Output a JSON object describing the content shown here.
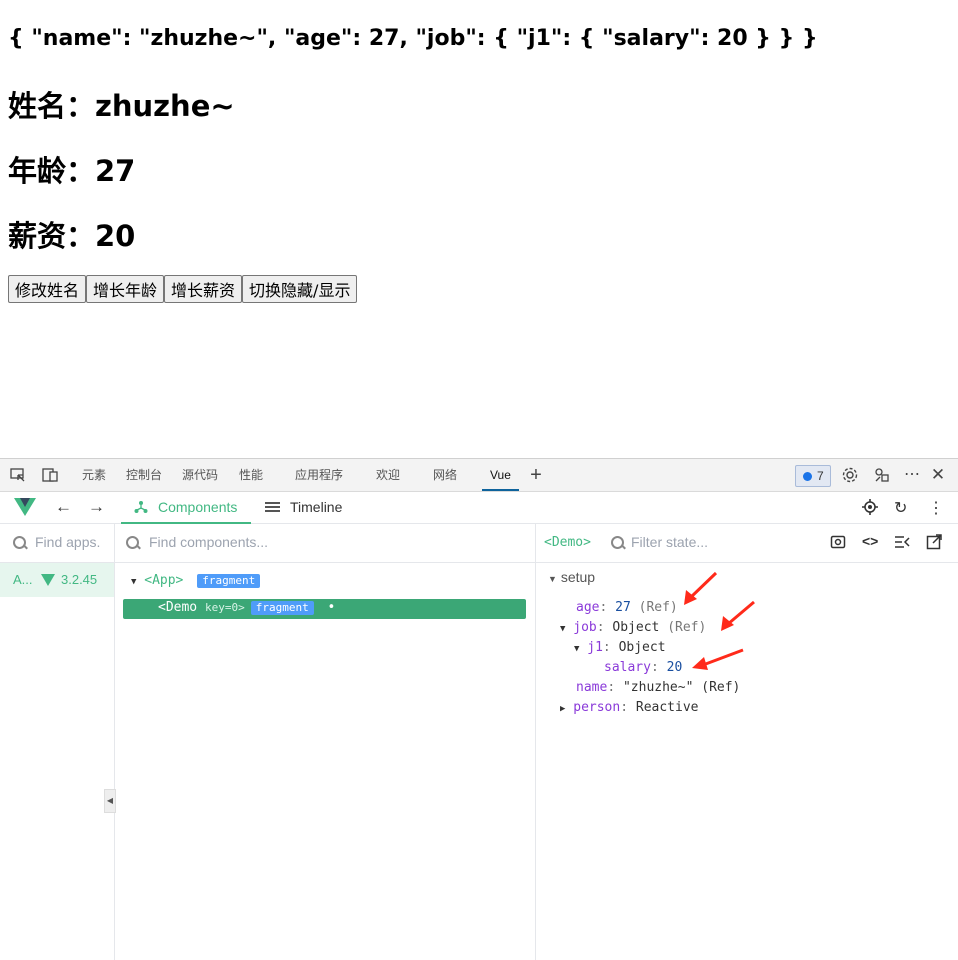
{
  "page": {
    "json_text": "{ \"name\": \"zhuzhe~\", \"age\": 27, \"job\": { \"j1\": { \"salary\": 20 } } }",
    "name_line": "姓名：zhuzhe~",
    "age_line": "年龄：27",
    "salary_line": "薪资：20",
    "buttons": [
      "修改姓名",
      "增长年龄",
      "增长薪资",
      "切换隐藏/显示"
    ]
  },
  "devtools": {
    "tabs": [
      "元素",
      "控制台",
      "源代码",
      "性能",
      "应用程序",
      "欢迎",
      "网络",
      "Vue"
    ],
    "issues_count": "7",
    "vue_tabs": {
      "components": "Components",
      "timeline": "Timeline"
    },
    "apps_search_placeholder": "Find apps.",
    "components_search_placeholder": "Find components...",
    "app_item": {
      "label": "A...",
      "version": "3.2.45"
    },
    "tree": {
      "root": "<App>",
      "root_badge": "fragment",
      "selected_name": "<Demo",
      "selected_key_label": "key",
      "selected_key_value": "=0>",
      "selected_badge": "fragment",
      "selected_dot": "•"
    },
    "state": {
      "crumb": "<Demo>",
      "filter_placeholder": "Filter state...",
      "section": "setup",
      "rows": {
        "age_key": "age",
        "age_val": "27",
        "age_meta": "(Ref)",
        "job_key": "job",
        "job_val": "Object",
        "job_meta": "(Ref)",
        "j1_key": "j1",
        "j1_val": "Object",
        "salary_key": "salary",
        "salary_val": "20",
        "name_key": "name",
        "name_val": "\"zhuzhe~\"",
        "name_meta": "(Ref)",
        "person_key": "person",
        "person_val": "Reactive"
      }
    }
  },
  "colors": {
    "vue_green": "#42b883",
    "annotation_red": "#ff2a1a",
    "selected_row": "#3ba776",
    "badge_blue": "#4f9cf9"
  }
}
